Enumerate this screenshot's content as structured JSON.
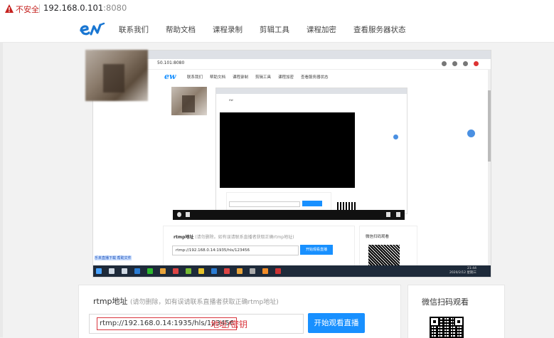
{
  "browser": {
    "security_label": "不安全",
    "url_host": "192.168.0.101",
    "url_port": ":8080"
  },
  "site": {
    "nav": [
      "联系我们",
      "帮助文档",
      "课程录制",
      "剪辑工具",
      "课程加密",
      "查看服务器状态"
    ]
  },
  "embedded": {
    "address": "50.101:8080",
    "nav": [
      "联系我们",
      "帮助文档",
      "课程录制",
      "剪辑工具",
      "课程加密",
      "查看服务器状态"
    ],
    "rtmp_label": "rtmp地址",
    "rtmp_hint": "(请勿删除。如有误请联系直播者获取正确rtmp地址)",
    "rtmp_value": "rtmp://192.168.0.14:1935/hls/123456",
    "start_button": "开始观看直播",
    "wechat_label": "微信扫码观看",
    "link_text": "乐未直播下载 帮助文件",
    "clock_time": "21:44",
    "clock_date": "2020/2/12 星期三"
  },
  "main": {
    "rtmp_label": "rtmp地址",
    "rtmp_hint": "(请勿删除，如有误请联系直播者获取正确rtmp地址)",
    "rtmp_value": "rtmp://192.168.0.14:1935/hls/123456",
    "annotation": "地址/密钥",
    "start_button": "开始观看直播"
  },
  "side": {
    "title": "微信扫码观看"
  },
  "colors": {
    "accent": "#1890ff",
    "annotation_red": "#d9363e",
    "insecure_red": "#c5221f"
  }
}
